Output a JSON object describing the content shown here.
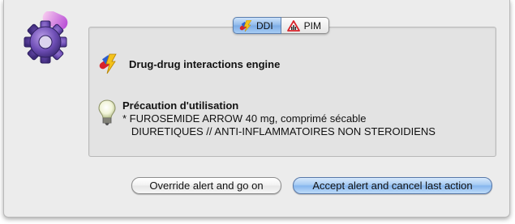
{
  "tabs": [
    {
      "label": "DDI",
      "icon": "ddi-icon",
      "selected": true
    },
    {
      "label": "PIM",
      "icon": "pim-icon",
      "selected": false
    }
  ],
  "engine": {
    "title": "Drug-drug interactions engine",
    "icon": "drug-interaction-icon"
  },
  "alert": {
    "icon": "lightbulb-icon",
    "title": "Précaution d'utilisation",
    "lines": [
      "* FUROSEMIDE ARROW 40 mg, comprimé sécable",
      "   DIURETIQUES // ANTI-INFLAMMATOIRES NON STEROIDIENS"
    ]
  },
  "buttons": {
    "override_label": "Override alert and go on",
    "accept_label": "Accept alert and cancel last action"
  },
  "colors": {
    "accent": "#8db8ea",
    "dialog_bg": "#ececec",
    "panel_bg": "#e3e3e3"
  }
}
